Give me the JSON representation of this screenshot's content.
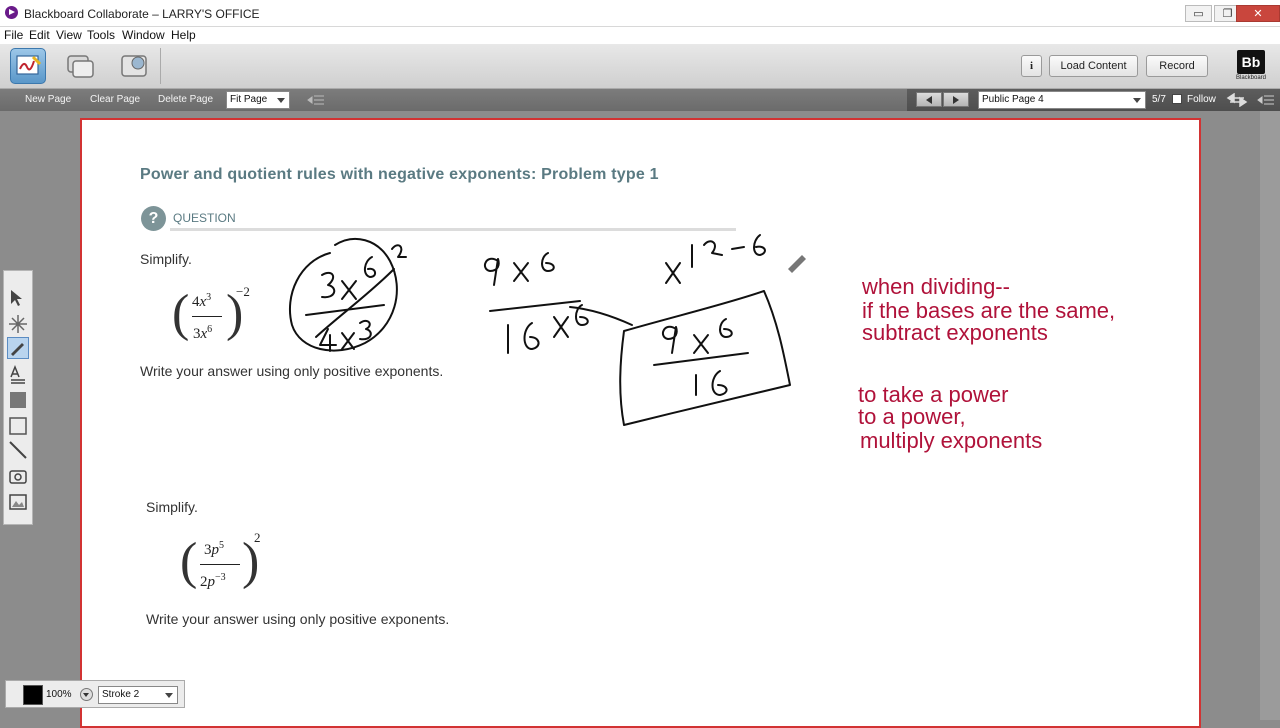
{
  "window": {
    "title": "Blackboard Collaborate – LARRY'S OFFICE",
    "minimize": "▭",
    "restore": "❐",
    "close": "✕"
  },
  "menu": [
    "File",
    "Edit",
    "View",
    "Tools",
    "Window",
    "Help"
  ],
  "toolbar": {
    "info_label": "i",
    "load_content_label": "Load Content",
    "record_label": "Record",
    "logo_mark": "Bb",
    "logo_text": "Blackboard"
  },
  "subbar": {
    "new_page": "New Page",
    "clear_page": "Clear Page",
    "delete_page": "Delete Page",
    "zoom_value": "Fit Page",
    "page_select_value": "Public Page 4",
    "page_count": "5/7",
    "follow_label": "Follow"
  },
  "content": {
    "title": "Power and quotient rules with negative exponents: Problem type 1",
    "question_icon": "?",
    "question_label": "QUESTION",
    "problem1": {
      "prompt": "Simplify.",
      "numerator_coef": "4",
      "numerator_var": "x",
      "numerator_exp": "3",
      "denominator_coef": "3",
      "denominator_var": "x",
      "denominator_exp": "6",
      "outer_exp": "−2",
      "instruction": "Write your answer using only positive exponents."
    },
    "problem2": {
      "prompt": "Simplify.",
      "numerator_coef": "3",
      "numerator_var": "p",
      "numerator_exp": "5",
      "denominator_coef": "2",
      "denominator_var": "p",
      "denominator_exp": "−3",
      "outer_exp": "2",
      "instruction": "Write your answer using only positive exponents."
    },
    "notes": {
      "line1": "when dividing--",
      "line2": "if the bases are the same,",
      "line3": "subtract exponents",
      "line4": "to take a power",
      "line5": "to a power,",
      "line6": "multiply exponents"
    }
  },
  "properties": {
    "opacity": "100%",
    "stroke_value": "Stroke 2",
    "color": "#000000"
  },
  "colors": {
    "ink_text": "#b0123a",
    "page_border": "#d23333",
    "title_color": "#5a7a82"
  }
}
